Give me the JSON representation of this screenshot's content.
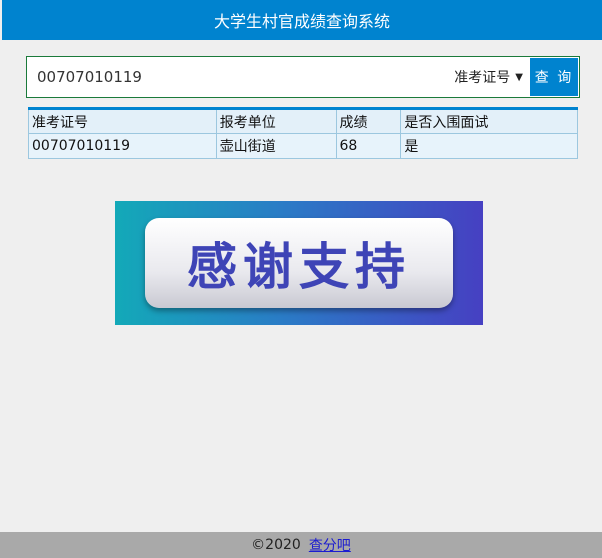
{
  "header": {
    "title": "大学生村官成绩查询系统"
  },
  "search": {
    "value": "00707010119",
    "type_selected": "准考证号",
    "button_label": "查 询"
  },
  "table": {
    "headers": [
      "准考证号",
      "报考单位",
      "成绩",
      "是否入围面试"
    ],
    "rows": [
      [
        "00707010119",
        "壶山街道",
        "68",
        "是"
      ]
    ]
  },
  "banner": {
    "text": "感谢支持"
  },
  "footer": {
    "copyright": "©2020",
    "link_label": "查分吧"
  },
  "colors": {
    "primary": "#0083cf",
    "banner_text": "#3e44b6"
  }
}
